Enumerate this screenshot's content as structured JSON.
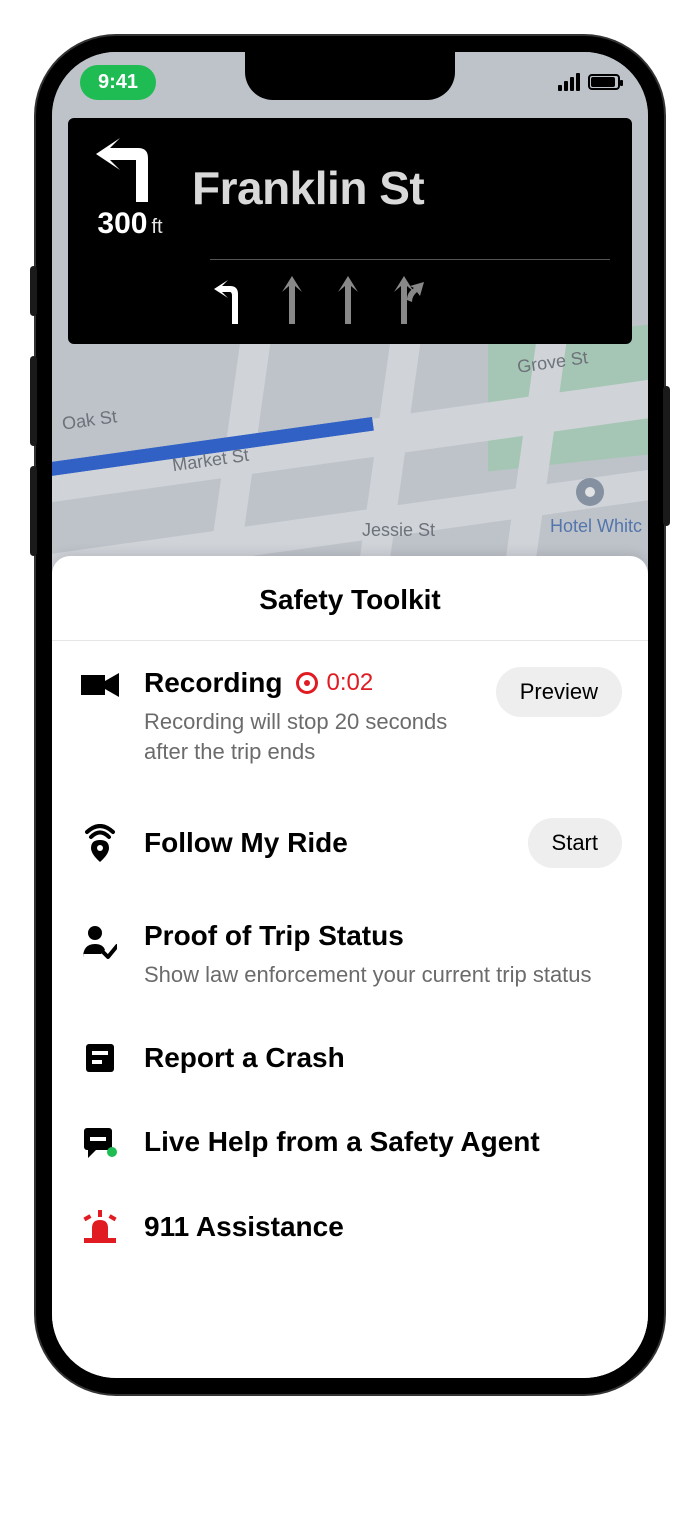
{
  "status_bar": {
    "time": "9:41"
  },
  "navigation": {
    "street": "Franklin St",
    "distance_value": "300",
    "distance_unit": "ft"
  },
  "map": {
    "labels": {
      "oak": "Oak St",
      "grove": "Grove St",
      "market": "Market St",
      "jessie": "Jessie St",
      "hotel": "Hotel Whitc"
    }
  },
  "sheet": {
    "title": "Safety Toolkit",
    "recording": {
      "title": "Recording",
      "timer": "0:02",
      "subtitle": "Recording will stop 20 seconds after the trip ends",
      "action": "Preview"
    },
    "follow": {
      "title": "Follow My Ride",
      "action": "Start"
    },
    "proof": {
      "title": "Proof of Trip Status",
      "subtitle": "Show law enforcement your current trip status"
    },
    "crash": {
      "title": "Report a Crash"
    },
    "live_help": {
      "title": "Live Help from a Safety Agent"
    },
    "emergency": {
      "title": "911 Assistance"
    }
  }
}
